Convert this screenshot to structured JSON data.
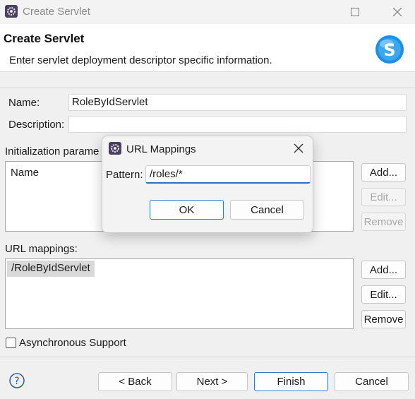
{
  "window": {
    "title": "Create Servlet",
    "icon": "servlet-wizard-icon"
  },
  "banner": {
    "title": "Create Servlet",
    "description": "Enter servlet deployment descriptor specific information.",
    "logo_letter": "S",
    "logo_color": "#1e8fe0"
  },
  "form": {
    "name_label": "Name:",
    "name_value": "RoleByIdServlet",
    "description_label": "Description:",
    "description_value": "",
    "init_params_label": "Initialization parame",
    "init_params_columns": [
      "Name"
    ],
    "init_add": "Add...",
    "init_edit": "Edit...",
    "init_remove": "Remove",
    "url_mappings_label": "URL mappings:",
    "url_mappings": [
      "/RoleByIdServlet"
    ],
    "url_add": "Add...",
    "url_edit": "Edit...",
    "url_remove": "Remove",
    "async_label": "Asynchronous Support",
    "async_checked": false
  },
  "footer": {
    "back": "< Back",
    "next": "Next >",
    "finish": "Finish",
    "cancel": "Cancel"
  },
  "dialog": {
    "title": "URL Mappings",
    "pattern_label": "Pattern:",
    "pattern_value": "/roles/*",
    "ok": "OK",
    "cancel": "Cancel"
  }
}
